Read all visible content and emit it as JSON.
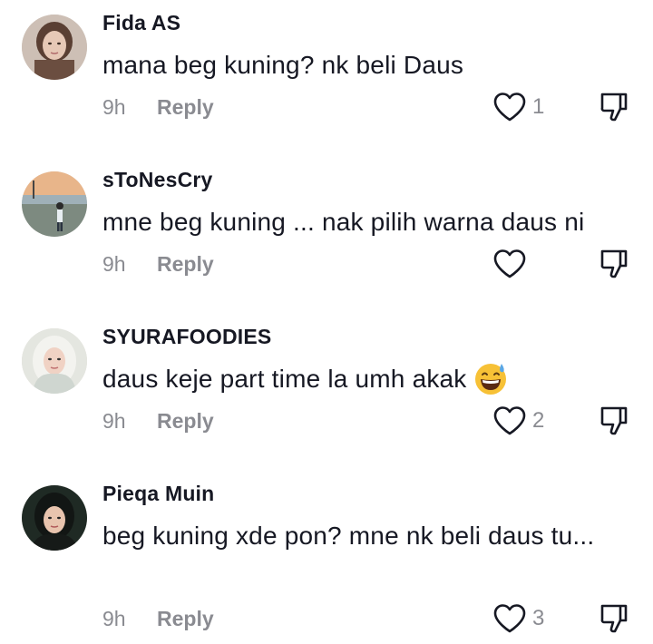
{
  "comments": [
    {
      "username": "Fida AS",
      "text": "mana beg kuning? nk beli Daus",
      "time": "9h",
      "reply_label": "Reply",
      "likes": "1"
    },
    {
      "username": "sToNesCry",
      "text": "mne beg kuning ... nak pilih warna daus ni",
      "time": "9h",
      "reply_label": "Reply",
      "likes": ""
    },
    {
      "username": "SYURAFOODIES",
      "text": "daus keje part time la umh akak",
      "emoji": "grinning-sweat-emoji",
      "time": "9h",
      "reply_label": "Reply",
      "likes": "2"
    },
    {
      "username": "Pieqa Muin",
      "text": "beg kuning xde pon? mne nk beli daus tu...",
      "time": "9h",
      "reply_label": "Reply",
      "likes": "3"
    }
  ],
  "icons": {
    "like": "heart-outline-icon",
    "dislike": "thumbs-down-icon"
  },
  "colors": {
    "text": "#161823",
    "muted": "#8a8b91"
  }
}
